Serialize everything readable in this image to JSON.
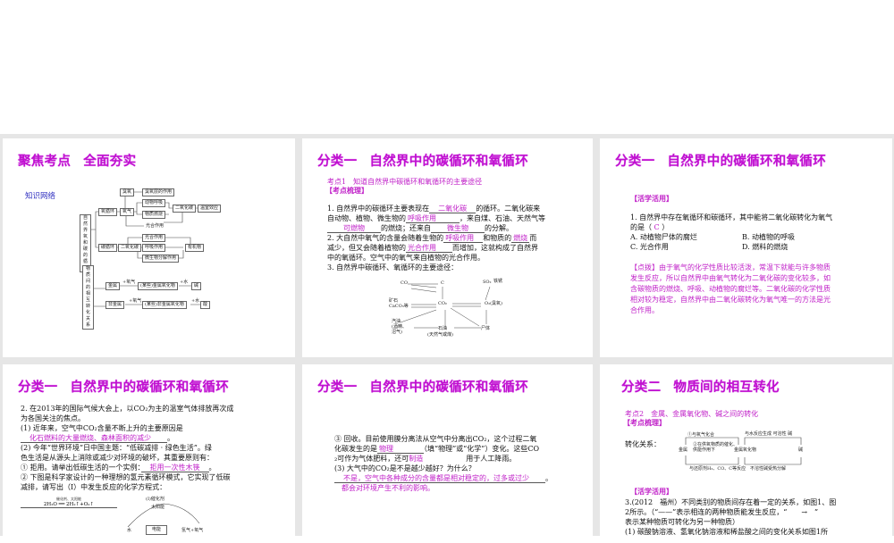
{
  "slides": [
    {
      "title_a": "聚焦考点",
      "title_b": "全面夯实",
      "section_label": "知识网络",
      "diagram": [
        "自然界氧和碳的循环",
        "氧循环",
        "臭氧",
        "臭氧层的作用",
        "氧气",
        "动物呼吸",
        "物质燃烧",
        "二氧化碳",
        "温室效应",
        "光合作用",
        "碳循环",
        "二氧化碳",
        "光合作用",
        "呼吸作用",
        "微生物分解作用",
        "有机物",
        "物质间的相互转化关系",
        "金属",
        "(某些)金属氧化物",
        "碱",
        "非金属",
        "(某些)非金属氧化物",
        "酸",
        "+氧气",
        "+水",
        "+氧气",
        "+水"
      ]
    },
    {
      "title_a": "分类一",
      "title_b": "自然界中的碳循环和氧循环",
      "subtitle": "考点1　知道自然界中碳循环和氧循环的主要途径",
      "tag": "【考点梳理】",
      "body": [
        [
          {
            "t": "1. 自然界中的碳循环主要表现在"
          },
          {
            "t": "　二氧化碳　",
            "a": 1
          },
          {
            "t": "的循环。二氧化碳来"
          }
        ],
        [
          {
            "t": "自动物、植物、微生物的"
          },
          {
            "t": "呼吸作用　　　",
            "a": 1
          },
          {
            "t": "，来自煤、石油、天然气等"
          }
        ],
        [
          {
            "t": "",
            "a": 0
          },
          {
            "t": "　　可燃物　　",
            "a": 1
          },
          {
            "t": "的燃烧；还来自"
          },
          {
            "t": "　　微生物　　",
            "a": 1
          },
          {
            "t": "的分解。"
          }
        ],
        [
          {
            "t": "2. 大自然中氧气的含量会随着生物的"
          },
          {
            "t": "呼吸作用　",
            "a": 1
          },
          {
            "t": "和物质的"
          },
          {
            "t": "燃烧",
            "a": 1
          },
          {
            "t": "而"
          }
        ],
        [
          {
            "t": "减少，但又会随着植物的"
          },
          {
            "t": "光合作用　　",
            "a": 1
          },
          {
            "t": "而增加，这就构成了自然界"
          }
        ],
        [
          {
            "t": "中的氧循环。空气中的氧气来自植物的光合作用。"
          }
        ],
        [
          {
            "t": "3. 自然界中碳循环、氧循环的主要途径："
          }
        ]
      ],
      "diagram": [
        "CO",
        "C",
        "SO₂",
        "铁锈",
        "矿石",
        "CaCO₃等",
        "CO₂",
        "O₂(臭氧)",
        "汽油",
        "(酒精、",
        "沼气)",
        "石油",
        "(天然气或煤)",
        "尸体"
      ]
    },
    {
      "title_a": "分类一",
      "title_b": "自然界中的碳循环和氧循环",
      "tag": "【活学活用】",
      "body": [
        [
          {
            "t": "1. 自然界中存在氧循环和碳循环，其中能将二氧化碳转化为氧气"
          }
        ],
        [
          {
            "t": "的是（ "
          },
          {
            "t": "C",
            "p": 1
          },
          {
            "t": " ）"
          }
        ]
      ],
      "options": [
        "A. 动植物尸体的腐烂",
        "B. 动植物的呼吸",
        "C. 光合作用",
        "D. 燃料的燃烧"
      ],
      "hint": [
        "【点拨】由于氧气的化学性质比较活泼，常温下就能与许多物质",
        "发生反应，所以自然界中由氧气转化为二氧化碳的变化较多，如",
        "含碳物质的燃烧、呼吸、动植物的腐烂等。二氧化碳的化学性质",
        "相对较为稳定，自然界中由二氧化碳转化为氧气唯一的方法是光",
        "合作用。"
      ]
    },
    {
      "title_a": "分类一",
      "title_b": "自然界中的碳循环和氧循环",
      "body": [
        [
          {
            "t": "2. 在2013年的国际气候大会上，以CO₂为主的温室气体排放再次成"
          }
        ],
        [
          {
            "t": "为各国关注的焦点。"
          }
        ],
        [
          {
            "t": "(1) 近年来，空气中CO₂含量不断上升的主要原因是"
          }
        ],
        [
          {
            "t": "　化石燃料的大量燃烧、森林面积的减少　　",
            "a": 1
          },
          {
            "t": "。"
          }
        ],
        [
          {
            "t": "(2) 今年“世界环境”日中国主题：“低碳减排 · 绿色生活”。绿"
          }
        ],
        [
          {
            "t": "色生活是从源头上消除或减少对环境的破坏，其重要原则有："
          }
        ],
        [
          {
            "t": "① 拒用。请举出低碳生活的一个实例："
          },
          {
            "t": "　拒用一次性木筷　",
            "a": 1
          },
          {
            "t": "。"
          }
        ],
        [
          {
            "t": "② 下图是科学家设计的一种理想的氢元素循环模式，它实现了低碳"
          }
        ],
        [
          {
            "t": "减排，请写出（Ⅰ）中发生反应的化学方程式："
          }
        ]
      ],
      "equation": "2H₂O ══ 2H₂↑+O₂↑",
      "eq_cond": "催化剂、太阳能",
      "cycle": [
        "(Ⅰ)催化剂",
        "太阳能",
        "水",
        "电能",
        "氢气+氧气"
      ]
    },
    {
      "title_a": "分类一",
      "title_b": "自然界中的碳循环和氧循环",
      "body": [
        [
          {
            "t": "③ 回收。目前使用膜分离法从空气中分离出CO₂，这个过程二氧"
          }
        ],
        [
          {
            "t": "化碳发生的是"
          },
          {
            "t": "物理　　　　",
            "a": 1
          },
          {
            "t": "（填“物理”或“化学”）变化。这些CO"
          }
        ],
        [
          {
            "t": "₂可作为气体肥料，还可"
          },
          {
            "t": "制造",
            "p": 1
          },
          {
            "t": "　　　　　　用于人工降雨。"
          }
        ],
        [
          {
            "t": "(3) 大气中的CO₂是不是越少越好？为什么？"
          }
        ],
        [
          {
            "t": "　不是，空气中各种成分的含量都是相对稳定的，过多或过少　　",
            "a": 1
          },
          {
            "t": "。"
          }
        ],
        [
          {
            "t": "　都会对环境产生不利的影响。",
            "p": 1
          }
        ]
      ]
    },
    {
      "title_a": "分类二",
      "title_b": "物质间的相互转化",
      "subtitle": "考点2　金属、金属氧化物、碱之间的转化",
      "tag": "【考点梳理】",
      "relation_label": "转化关系：",
      "diagram": [
        "①与氧气化合",
        "②在供氧物质的催化、",
        "供能作用下",
        "金属",
        "金属氧化物",
        "与水反应生成 可溶性 碱",
        "碱",
        "与还原剂H₂、CO、C等反应",
        "不溶性碱受热分解"
      ],
      "tag2": "【活学活用】",
      "body": [
        [
          {
            "t": "3.(2012　福州）不同类别的物质间存在着一定的关系，如图1、图"
          }
        ],
        [
          {
            "t": "2所示。（“——”表示相连的两种物质能发生反应，“　　→　”"
          }
        ],
        [
          {
            "t": "表示某种物质可转化为另一种物质）"
          }
        ],
        [
          {
            "t": "(1) 碳酸钠溶液、氢氧化钠溶液和稀盐酸之间的变化关系如图1所"
          }
        ]
      ]
    }
  ]
}
